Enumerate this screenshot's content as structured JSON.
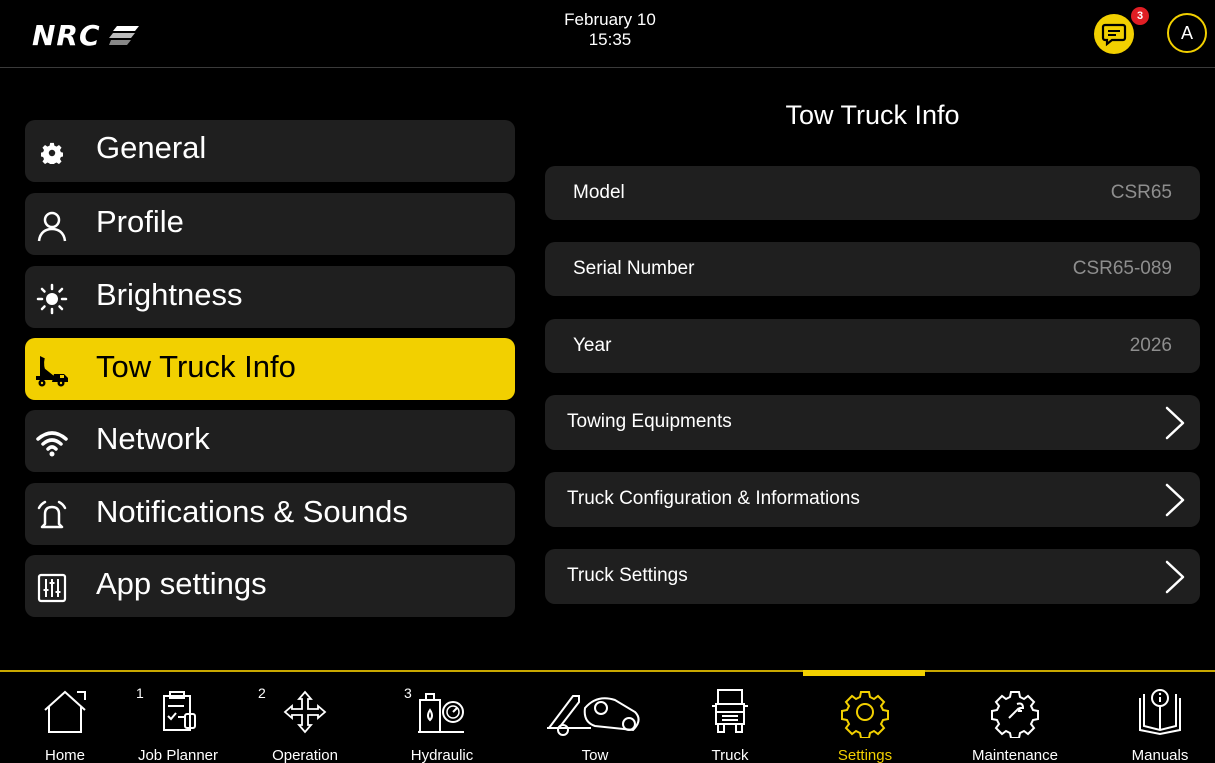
{
  "header": {
    "logo_text": "NRC",
    "date": "February 10",
    "time": "15:35",
    "messages_badge": "3",
    "avatar_initial": "A",
    "accent_color": "#f2d000"
  },
  "menu": {
    "items": [
      {
        "label": "General",
        "icon": "gear-icon",
        "active": false
      },
      {
        "label": "Profile",
        "icon": "user-icon",
        "active": false
      },
      {
        "label": "Brightness",
        "icon": "sun-icon",
        "active": false
      },
      {
        "label": "Tow Truck Info",
        "icon": "tow-truck-icon",
        "active": true
      },
      {
        "label": "Network",
        "icon": "wifi-icon",
        "active": false
      },
      {
        "label": "Notifications & Sounds",
        "icon": "bell-icon",
        "active": false
      },
      {
        "label": "App settings",
        "icon": "sliders-icon",
        "active": false
      }
    ]
  },
  "panel": {
    "title": "Tow Truck Info",
    "info": [
      {
        "label": "Model",
        "value": "CSR65"
      },
      {
        "label": "Serial Number",
        "value": "CSR65-089"
      },
      {
        "label": "Year",
        "value": "2026"
      }
    ],
    "links": [
      {
        "label": "Towing Equipments"
      },
      {
        "label": "Truck Configuration & Informations"
      },
      {
        "label": "Truck Settings"
      }
    ]
  },
  "bottom_nav": {
    "tabs": [
      {
        "label": "Home",
        "number": ""
      },
      {
        "label": "Job Planner",
        "number": "1"
      },
      {
        "label": "Operation",
        "number": "2"
      },
      {
        "label": "Hydraulic",
        "number": "3"
      },
      {
        "label": "Tow",
        "number": ""
      },
      {
        "label": "Truck",
        "number": ""
      },
      {
        "label": "Settings",
        "number": "",
        "active": true
      },
      {
        "label": "Maintenance",
        "number": ""
      },
      {
        "label": "Manuals",
        "number": ""
      }
    ]
  }
}
